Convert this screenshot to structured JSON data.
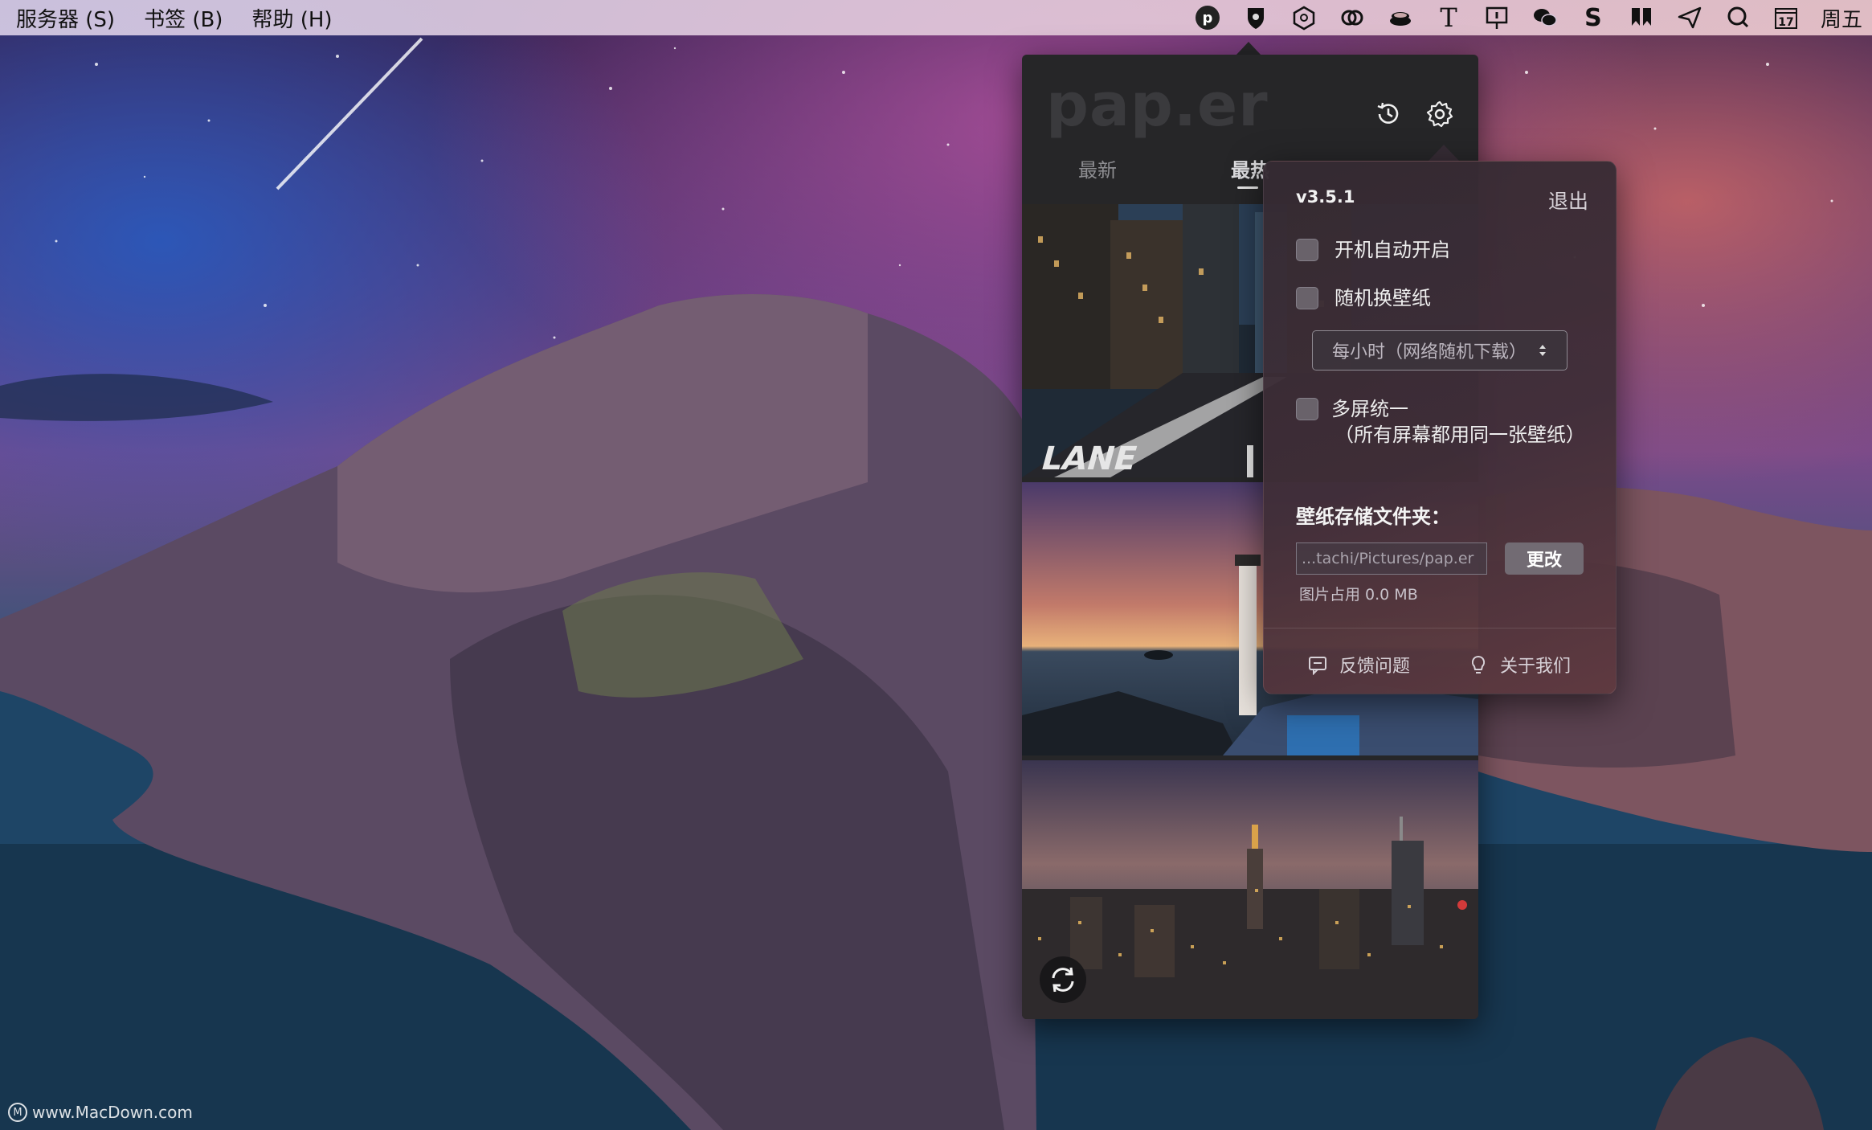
{
  "menubar": {
    "items": [
      {
        "label": "服务器 (S)"
      },
      {
        "label": "书签 (B)"
      },
      {
        "label": "帮助 (H)"
      }
    ],
    "tray": {
      "paper_icon_letter": "p",
      "notepad_icon_letter": "T",
      "s_icon_letter": "S",
      "calendar_day": "17",
      "weekday": "周五"
    }
  },
  "app": {
    "logo": "pap.er",
    "tabs": [
      {
        "label": "最新",
        "active": false
      },
      {
        "label": "最热",
        "active": true
      }
    ]
  },
  "settings": {
    "version": "v3.5.1",
    "quit_label": "退出",
    "auto_start_label": "开机自动开启",
    "random_wallpaper_label": "随机换壁纸",
    "interval_selected": "每小时（网络随机下载）",
    "multi_screen_label": "多屏统一",
    "multi_screen_sub": "（所有屏幕都用同一张壁纸）",
    "folder_title": "壁纸存储文件夹：",
    "folder_path": "...tachi/Pictures/pap.er",
    "change_button": "更改",
    "usage": "图片占用 0.0 MB",
    "feedback_label": "反馈问题",
    "about_label": "关于我们"
  },
  "watermark": {
    "logo_letter": "M",
    "text": "www.MacDown.com"
  },
  "colors": {
    "panel_bg": "#262628",
    "popover_accent": "#603a40",
    "menubar_text": "#111111"
  }
}
